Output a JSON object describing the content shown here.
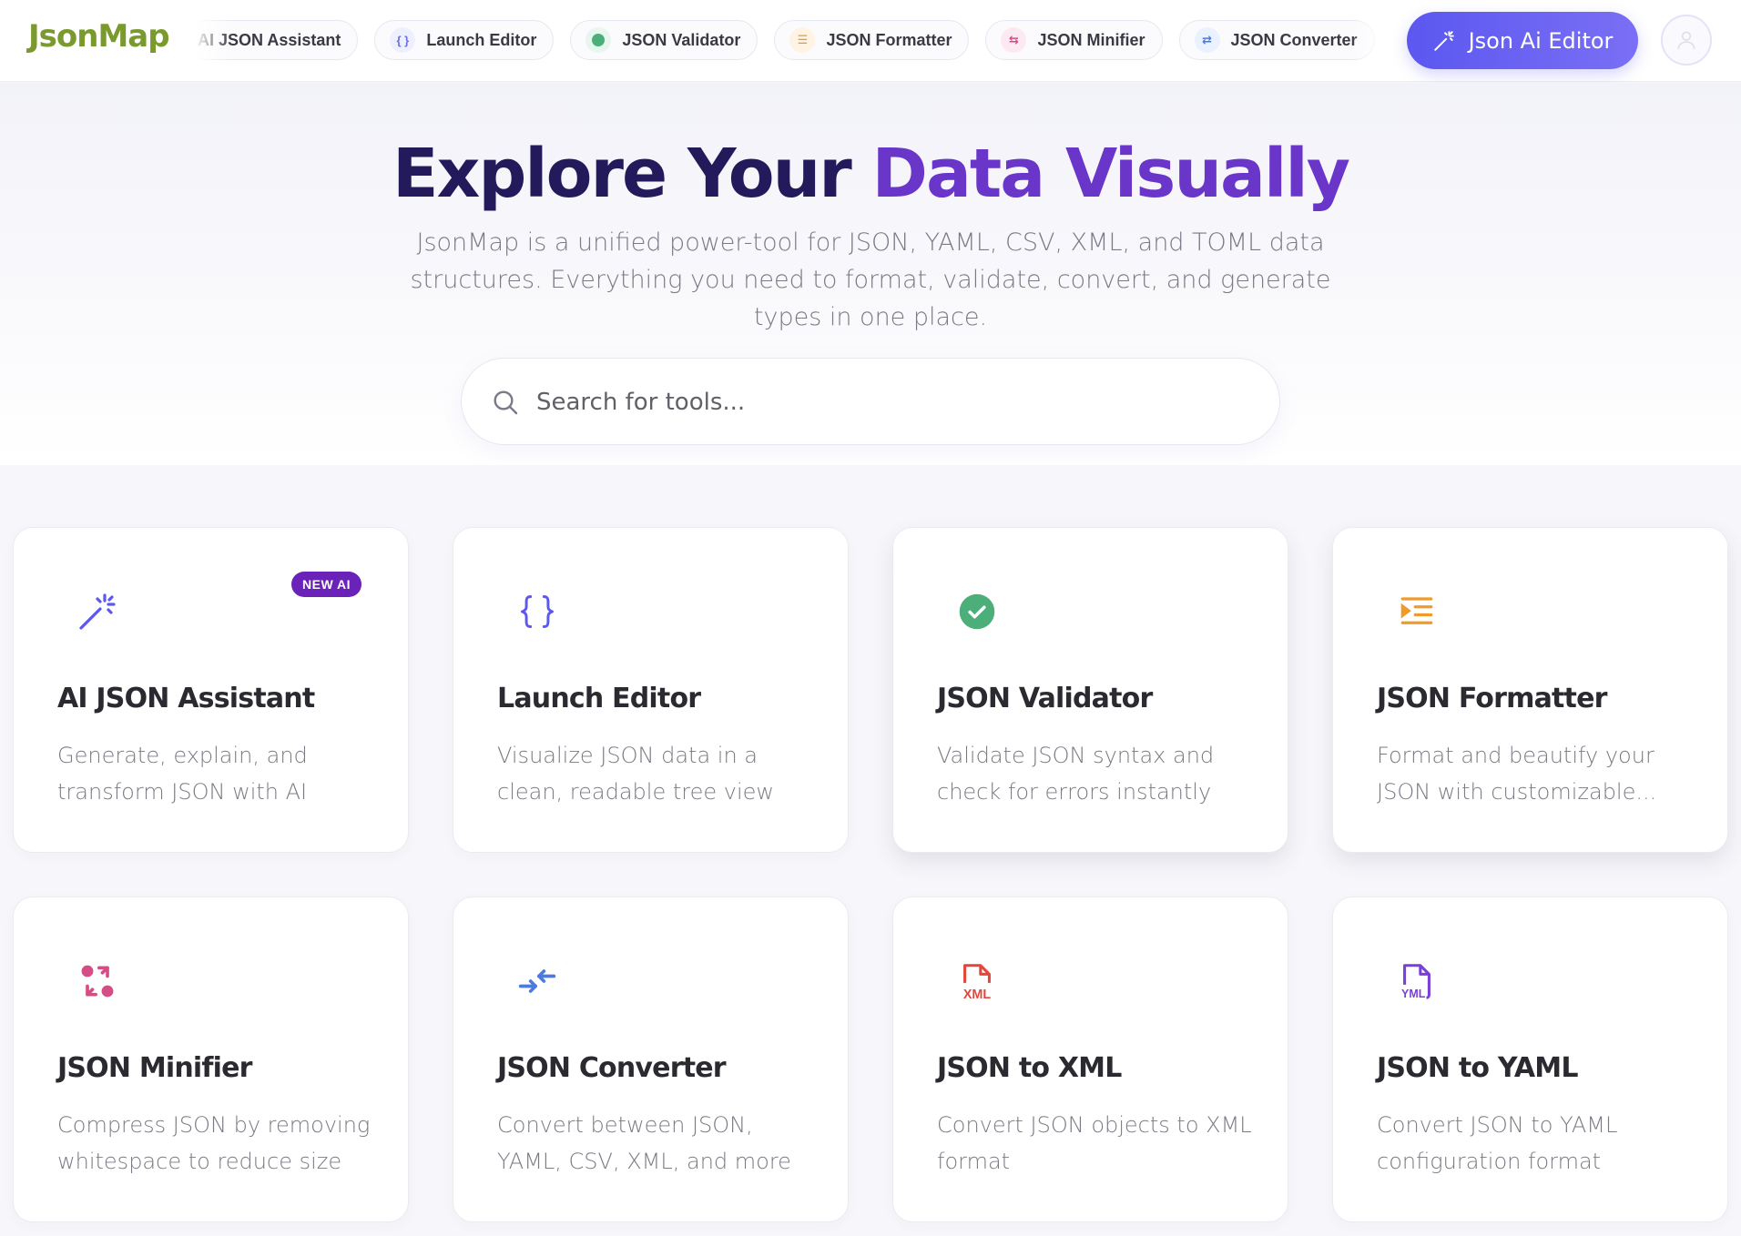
{
  "brand": {
    "name": "JsonMap"
  },
  "nav": {
    "pills": [
      {
        "label": "AI JSON Assistant",
        "icon": ""
      },
      {
        "label": "Launch Editor",
        "icon": "braces-icon"
      },
      {
        "label": "JSON Validator",
        "icon": "check-circle-icon"
      },
      {
        "label": "JSON Formatter",
        "icon": "indent-icon"
      },
      {
        "label": "JSON Minifier",
        "icon": "shuffle-icon"
      },
      {
        "label": "JSON Converter",
        "icon": "arrows-in-icon"
      }
    ],
    "cta_label": "Json Ai Editor",
    "cta_icon": "magic-wand-icon",
    "avatar_icon": "user-icon"
  },
  "hero": {
    "title_part1": "Explore Your ",
    "title_part2": "Data Visually",
    "subtitle": "JsonMap is a unified power-tool for JSON, YAML, CSV, XML, and TOML data structures. Everything you need to format, validate, convert, and generate types in one place.",
    "search_placeholder": "Search for tools..."
  },
  "cards": [
    {
      "title": "AI JSON Assistant",
      "desc": "Generate, explain, and transform JSON with AI",
      "icon": "magic-wand-icon",
      "badge": "NEW AI",
      "color": "#5b57f0"
    },
    {
      "title": "Launch Editor",
      "desc": "Visualize JSON data in a clean, readable tree view",
      "icon": "braces-icon",
      "color": "#5b57f0"
    },
    {
      "title": "JSON Validator",
      "desc": "Validate JSON syntax and check for errors instantly",
      "icon": "check-circle-icon",
      "color": "#4caf7a"
    },
    {
      "title": "JSON Formatter",
      "desc": "Format and beautify your JSON with customizable...",
      "icon": "indent-icon",
      "color": "#f09a2a"
    },
    {
      "title": "JSON Minifier",
      "desc": "Compress JSON by removing whitespace to reduce size",
      "icon": "shuffle-icon",
      "color": "#d64d86"
    },
    {
      "title": "JSON Converter",
      "desc": "Convert between JSON, YAML, CSV, XML, and more",
      "icon": "arrows-in-icon",
      "color": "#4b7be0"
    },
    {
      "title": "JSON to XML",
      "desc": "Convert JSON objects to XML format",
      "icon": "xml-file-icon",
      "icon_text": "XML",
      "color": "#e2463c"
    },
    {
      "title": "JSON to YAML",
      "desc": "Convert JSON to YAML configuration format",
      "icon": "yaml-file-icon",
      "icon_text": "YML",
      "color": "#7a3fd6"
    }
  ]
}
